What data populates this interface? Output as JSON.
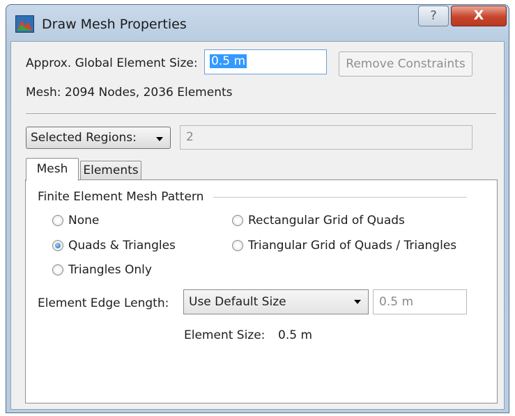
{
  "window": {
    "title": "Draw Mesh Properties",
    "help_glyph": "?",
    "close_glyph": "X"
  },
  "header": {
    "global_size_label": "Approx. Global Element Size:",
    "global_size_value": "0.5 m",
    "remove_constraints_label": "Remove Constraints",
    "mesh_info": "Mesh:  2094 Nodes, 2036 Elements"
  },
  "regions": {
    "selector_value": "Selected Regions:",
    "count_value": "2"
  },
  "tabs": [
    {
      "label": "Mesh",
      "active": true
    },
    {
      "label": "Elements",
      "active": false
    }
  ],
  "mesh_tab": {
    "group_title": "Finite Element Mesh Pattern",
    "options": [
      {
        "label": "None",
        "selected": false
      },
      {
        "label": "Quads & Triangles",
        "selected": true
      },
      {
        "label": "Triangles Only",
        "selected": false
      },
      {
        "label": "Rectangular Grid of Quads",
        "selected": false
      },
      {
        "label": "Triangular Grid of Quads / Triangles",
        "selected": false
      }
    ],
    "edge_length_label": "Element Edge Length:",
    "edge_length_option": "Use Default Size",
    "edge_length_value": "0.5 m",
    "element_size_label": "Element Size:",
    "element_size_value": "0.5 m"
  },
  "colors": {
    "selection": "#3399ff",
    "close_button": "#c7442b",
    "title_bar": "#b9cde2"
  }
}
